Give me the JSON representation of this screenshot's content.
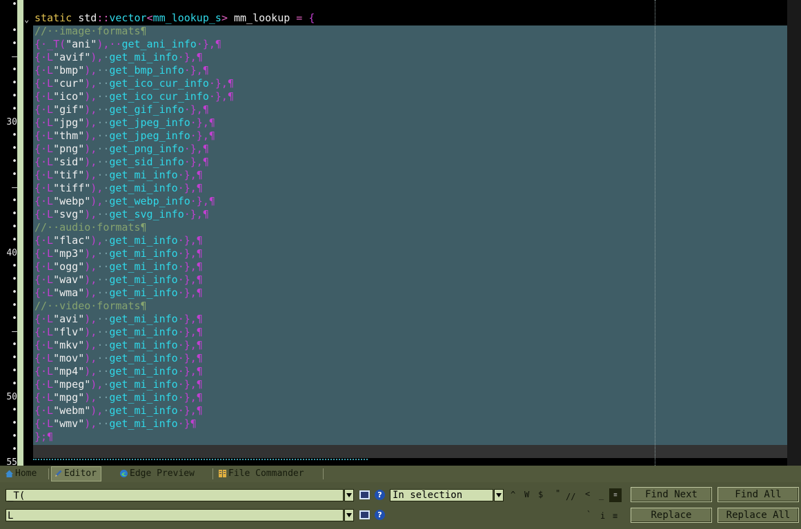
{
  "gutter": {
    "line_labels": [
      "•",
      "",
      "•",
      "•",
      "–",
      "•",
      "•",
      "•",
      "•",
      "30",
      "•",
      "•",
      "•",
      "•",
      "–",
      "•",
      "•",
      "•",
      "•",
      "40",
      "•",
      "•",
      "•",
      "•",
      "•",
      "–",
      "•",
      "•",
      "•",
      "•",
      "50",
      "•",
      "•",
      "•",
      "•",
      "55"
    ]
  },
  "code": {
    "header": {
      "kw": "static ",
      "std": "std",
      "sep": "::",
      "vec": "vector",
      "lt": "<",
      "type": "mm_lookup_s",
      "gt": "> ",
      "name": "mm_lookup",
      "eq": " = ",
      "brace": "{"
    },
    "comments": {
      "image": "//··image·formats¶",
      "audio": "//··audio·formats¶",
      "video": "//··video·formats¶"
    },
    "ani_row": {
      "open": "{·_T(",
      "str": "\"ani\"",
      "close": "),··",
      "fn": "get_ani_info",
      "end": "·},¶"
    },
    "rows": [
      {
        "ext": "\"avif\"",
        "gap": "·",
        "fn": "get_mi_info"
      },
      {
        "ext": "\"bmp\"",
        "gap": "··",
        "fn": "get_bmp_info"
      },
      {
        "ext": "\"cur\"",
        "gap": "··",
        "fn": "get_ico_cur_info"
      },
      {
        "ext": "\"ico\"",
        "gap": "··",
        "fn": "get_ico_cur_info"
      },
      {
        "ext": "\"gif\"",
        "gap": "··",
        "fn": "get_gif_info"
      },
      {
        "ext": "\"jpg\"",
        "gap": "··",
        "fn": "get_jpeg_info"
      },
      {
        "ext": "\"thm\"",
        "gap": "··",
        "fn": "get_jpeg_info"
      },
      {
        "ext": "\"png\"",
        "gap": "··",
        "fn": "get_png_info"
      },
      {
        "ext": "\"sid\"",
        "gap": "··",
        "fn": "get_sid_info"
      },
      {
        "ext": "\"tif\"",
        "gap": "··",
        "fn": "get_mi_info"
      },
      {
        "ext": "\"tiff\"",
        "gap": "·",
        "fn": "get_mi_info"
      },
      {
        "ext": "\"webp\"",
        "gap": "·",
        "fn": "get_webp_info"
      },
      {
        "ext": "\"svg\"",
        "gap": "··",
        "fn": "get_svg_info"
      },
      {
        "ext": "\"flac\"",
        "gap": "·",
        "fn": "get_mi_info"
      },
      {
        "ext": "\"mp3\"",
        "gap": "··",
        "fn": "get_mi_info"
      },
      {
        "ext": "\"ogg\"",
        "gap": "··",
        "fn": "get_mi_info"
      },
      {
        "ext": "\"wav\"",
        "gap": "··",
        "fn": "get_mi_info"
      },
      {
        "ext": "\"wma\"",
        "gap": "··",
        "fn": "get_mi_info"
      },
      {
        "ext": "\"avi\"",
        "gap": "··",
        "fn": "get_mi_info"
      },
      {
        "ext": "\"flv\"",
        "gap": "··",
        "fn": "get_mi_info"
      },
      {
        "ext": "\"mkv\"",
        "gap": "··",
        "fn": "get_mi_info"
      },
      {
        "ext": "\"mov\"",
        "gap": "··",
        "fn": "get_mi_info"
      },
      {
        "ext": "\"mp4\"",
        "gap": "··",
        "fn": "get_mi_info"
      },
      {
        "ext": "\"mpeg\"",
        "gap": "·",
        "fn": "get_mi_info"
      },
      {
        "ext": "\"mpg\"",
        "gap": "··",
        "fn": "get_mi_info"
      },
      {
        "ext": "\"webm\"",
        "gap": "·",
        "fn": "get_mi_info"
      },
      {
        "ext": "\"wmv\"",
        "gap": "··",
        "fn": "get_mi_info",
        "last": true
      }
    ],
    "row_prefix": "{·L",
    "row_close": "),",
    "row_end": "·},¶",
    "row_end_last": "·}¶",
    "closing": "};¶"
  },
  "tabs": [
    {
      "label": "Home",
      "icon": "home-icon"
    },
    {
      "label": "Editor",
      "icon": "pencil-icon",
      "active": true
    },
    {
      "label": "Edge Preview",
      "icon": "edge-icon"
    },
    {
      "label": "File Commander",
      "icon": "file-commander-icon"
    }
  ],
  "find": {
    "find_value": "_T(",
    "replace_value": "L",
    "scope_value": "In selection",
    "options_row1": [
      "^",
      "W",
      "$",
      "\"",
      "//",
      "<",
      "_"
    ],
    "options_row2": [
      "`",
      "i",
      "≡"
    ],
    "find_next": "Find Next",
    "find_all": "Find All",
    "replace": "Replace",
    "replace_all": "Replace All"
  }
}
